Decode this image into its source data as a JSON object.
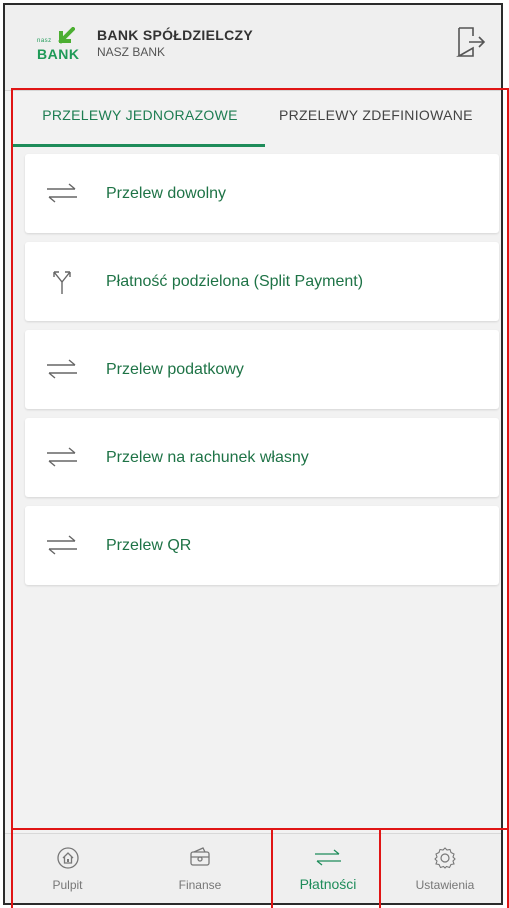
{
  "header": {
    "logo_small": "nasz",
    "logo_text": "BANK",
    "bank_name": "BANK SPÓŁDZIELCZY",
    "bank_subtitle": "NASZ BANK",
    "logout_icon": "logout-icon"
  },
  "tabs": [
    {
      "label": "PRZELEWY JEDNORAZOWE",
      "active": true
    },
    {
      "label": "PRZELEWY ZDEFINIOWANE",
      "active": false
    }
  ],
  "transfers": [
    {
      "label": "Przelew dowolny",
      "icon": "transfer-arrows-icon"
    },
    {
      "label": "Płatność podzielona (Split Payment)",
      "icon": "split-payment-icon"
    },
    {
      "label": "Przelew podatkowy",
      "icon": "transfer-arrows-icon"
    },
    {
      "label": "Przelew na rachunek własny",
      "icon": "transfer-arrows-icon"
    },
    {
      "label": "Przelew QR",
      "icon": "transfer-arrows-icon"
    }
  ],
  "bottom_nav": [
    {
      "label": "Pulpit",
      "icon": "home-icon",
      "active": false
    },
    {
      "label": "Finanse",
      "icon": "wallet-icon",
      "active": false
    },
    {
      "label": "Płatności",
      "icon": "transfer-arrows-icon",
      "active": true
    },
    {
      "label": "Ustawienia",
      "icon": "gear-icon",
      "active": false
    }
  ],
  "colors": {
    "brand_green": "#1e8c5a",
    "highlight_red": "#e01515"
  }
}
